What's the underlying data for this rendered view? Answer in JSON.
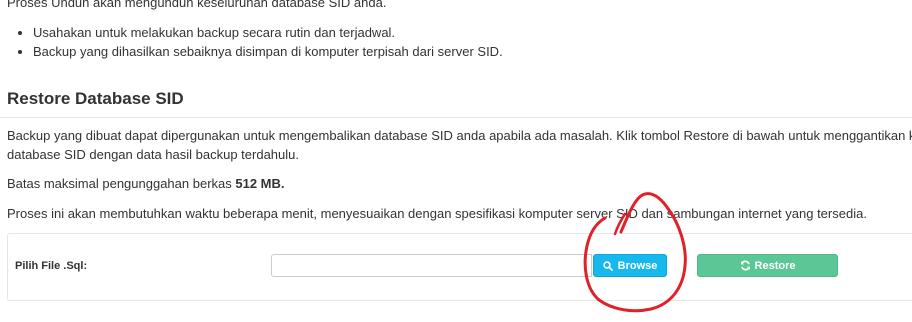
{
  "intro": {
    "text": "Proses Unduh akan mengunduh keseluruhan database SID anda."
  },
  "bullets": [
    "Usahakan untuk melakukan backup secara rutin dan terjadwal.",
    "Backup yang dihasilkan sebaiknya disimpan di komputer terpisah dari server SID."
  ],
  "restore_section": {
    "title": "Restore Database SID",
    "paragraph1_line1": "Backup yang dibuat dapat dipergunakan untuk mengembalikan database SID anda apabila ada masalah. Klik tombol Restore di bawah untuk menggantikan keseluruhan",
    "paragraph1_line2": "database SID dengan data hasil backup terdahulu.",
    "max_upload_prefix": "Batas maksimal pengunggahan berkas ",
    "max_upload_value": "512 MB.",
    "paragraph3": "Proses ini akan membutuhkan waktu beberapa menit, menyesuaikan dengan spesifikasi komputer server SID dan sambungan internet yang tersedia."
  },
  "form": {
    "label": "Pilih File .Sql:",
    "file_value": "",
    "browse_label": "Browse",
    "browse_icon": "search-icon",
    "restore_label": "Restore",
    "restore_icon": "refresh-icon"
  },
  "colors": {
    "browse_button": "#17b8ec",
    "restore_button": "#5cc796",
    "annotation_circle": "#e0202a"
  }
}
